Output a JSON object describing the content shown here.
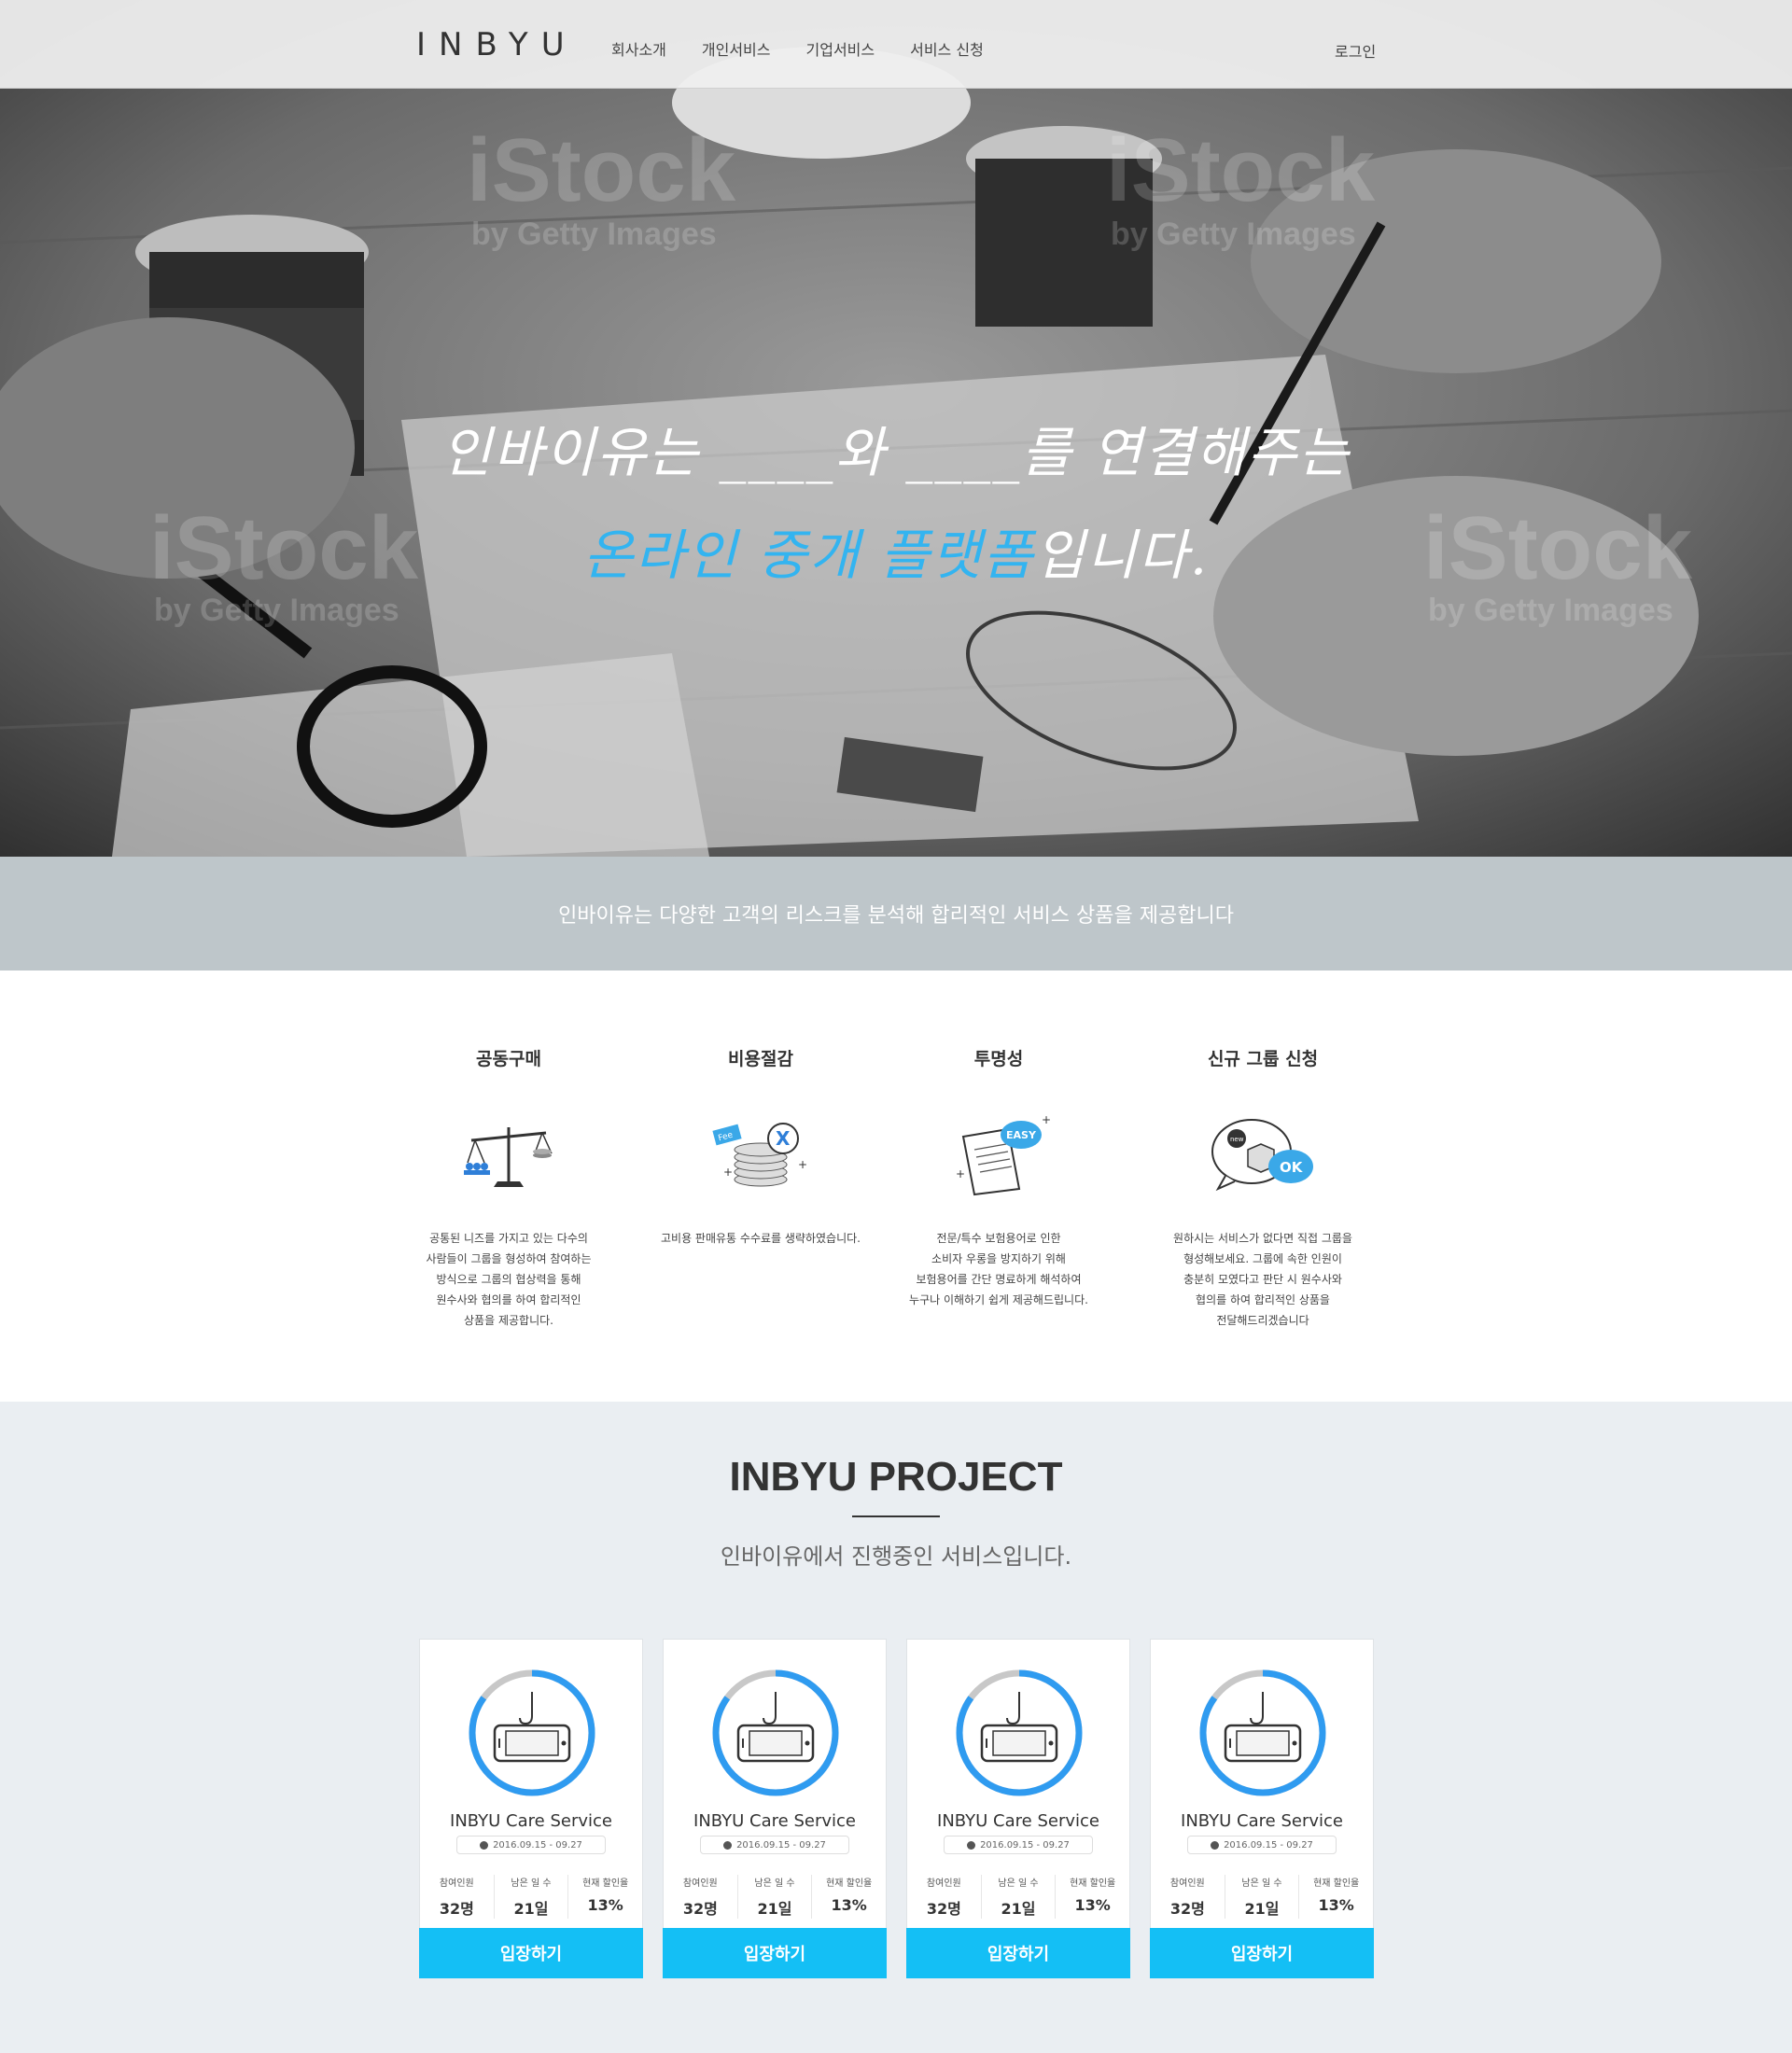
{
  "header": {
    "logo": "INBYU",
    "nav": [
      "회사소개",
      "개인서비스",
      "기업서비스",
      "서비스 신청"
    ],
    "login": "로그인"
  },
  "hero": {
    "line1": "인바이유는 ____와 ____를 연결해주는",
    "line2_highlight": "온라인 중개 플랫폼",
    "line2_rest": "입니다.",
    "watermark_text": "iStock",
    "watermark_sub": "by Getty Images"
  },
  "band": {
    "text": "인바이유는 다양한 고객의 리스크를 분석해 합리적인 서비스 상품을 제공합니다"
  },
  "features": [
    {
      "title": "공동구매",
      "icon": "scale-icon",
      "desc": [
        "공통된 니즈를 가지고 있는 다수의",
        "사람들이 그룹을 형성하여 참여하는",
        "방식으로 그룹의 협상력을 통해",
        "원수사와 협의를 하여 합리적인",
        "상품을 제공합니다."
      ]
    },
    {
      "title": "비용절감",
      "icon": "fee-coins-icon",
      "desc": [
        "고비용 판매유통 수수료를 생략하였습니다."
      ]
    },
    {
      "title": "투명성",
      "icon": "easy-document-icon",
      "desc": [
        "전문/특수 보험용어로 인한",
        "소비자 우롱을 방지하기 위해",
        "보험용어를 간단 명료하게 해석하여",
        "누구나 이해하기 쉽게 제공해드립니다."
      ]
    },
    {
      "title": "신규 그룹 신청",
      "icon": "new-group-ok-icon",
      "desc": [
        "원하시는 서비스가 없다면 직접 그룹을",
        "형성해보세요. 그룹에 속한 인원이",
        "충분히 모였다고 판단 시 원수사와",
        "협의를 하여 합리적인 상품을",
        "전달해드리겠습니다"
      ]
    }
  ],
  "project": {
    "title": "INBYU PROJECT",
    "subtitle": "인바이유에서 진행중인 서비스입니다.",
    "cards": [
      {
        "title": "INBYU Care Service",
        "date": "2016.09.15 - 09.27",
        "stats": [
          {
            "label": "참여인원",
            "value": "32명"
          },
          {
            "label": "남은 일 수",
            "value": "21일"
          },
          {
            "label": "현재 할인율",
            "value": "13%"
          }
        ],
        "button": "입장하기",
        "progress": 0.85
      },
      {
        "title": "INBYU Care Service",
        "date": "2016.09.15 - 09.27",
        "stats": [
          {
            "label": "참여인원",
            "value": "32명"
          },
          {
            "label": "남은 일 수",
            "value": "21일"
          },
          {
            "label": "현재 할인율",
            "value": "13%"
          }
        ],
        "button": "입장하기",
        "progress": 0.85
      },
      {
        "title": "INBYU Care Service",
        "date": "2016.09.15 - 09.27",
        "stats": [
          {
            "label": "참여인원",
            "value": "32명"
          },
          {
            "label": "남은 일 수",
            "value": "21일"
          },
          {
            "label": "현재 할인율",
            "value": "13%"
          }
        ],
        "button": "입장하기",
        "progress": 0.85
      },
      {
        "title": "INBYU Care Service",
        "date": "2016.09.15 - 09.27",
        "stats": [
          {
            "label": "참여인원",
            "value": "32명"
          },
          {
            "label": "남은 일 수",
            "value": "21일"
          },
          {
            "label": "현재 할인율",
            "value": "13%"
          }
        ],
        "button": "입장하기",
        "progress": 0.85
      }
    ]
  },
  "colors": {
    "accent": "#14bff5",
    "ring": "#2f9bf0",
    "band": "#bec6ca",
    "project_bg": "#eaeef2"
  }
}
